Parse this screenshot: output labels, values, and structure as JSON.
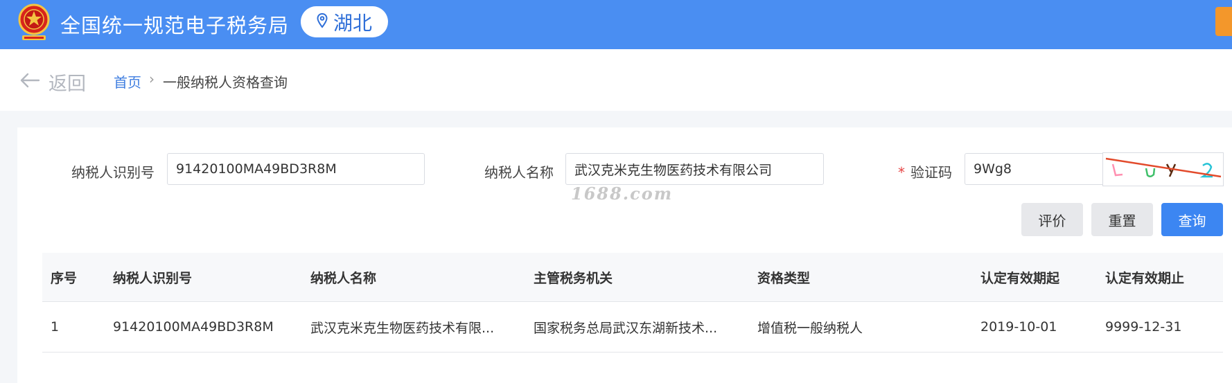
{
  "header": {
    "title": "全国统一规范电子税务局",
    "region": "湖北",
    "emblem_icon": "national-emblem-icon",
    "brand_color": "#4a8ef2"
  },
  "breadcrumb": {
    "back_label": "返回",
    "home": "首页",
    "separator": "›",
    "current": "一般纳税人资格查询"
  },
  "form": {
    "taxpayer_id": {
      "label": "纳税人识别号",
      "value": "91420100MA49BD3R8M"
    },
    "taxpayer_name": {
      "label": "纳税人名称",
      "value": "武汉克米克生物医药技术有限公司"
    },
    "captcha": {
      "required_mark": "*",
      "label": "验证码",
      "value": "9Wg8"
    }
  },
  "watermark": "1688.com",
  "buttons": {
    "evaluate": "评价",
    "reset": "重置",
    "query": "查询"
  },
  "table": {
    "headers": [
      "序号",
      "纳税人识别号",
      "纳税人名称",
      "主管税务机关",
      "资格类型",
      "认定有效期起",
      "认定有效期止"
    ],
    "rows": [
      [
        "1",
        "91420100MA49BD3R8M",
        "武汉克米克生物医药技术有限...",
        "国家税务总局武汉东湖新技术...",
        "增值税一般纳税人",
        "2019-10-01",
        "9999-12-31"
      ]
    ]
  }
}
